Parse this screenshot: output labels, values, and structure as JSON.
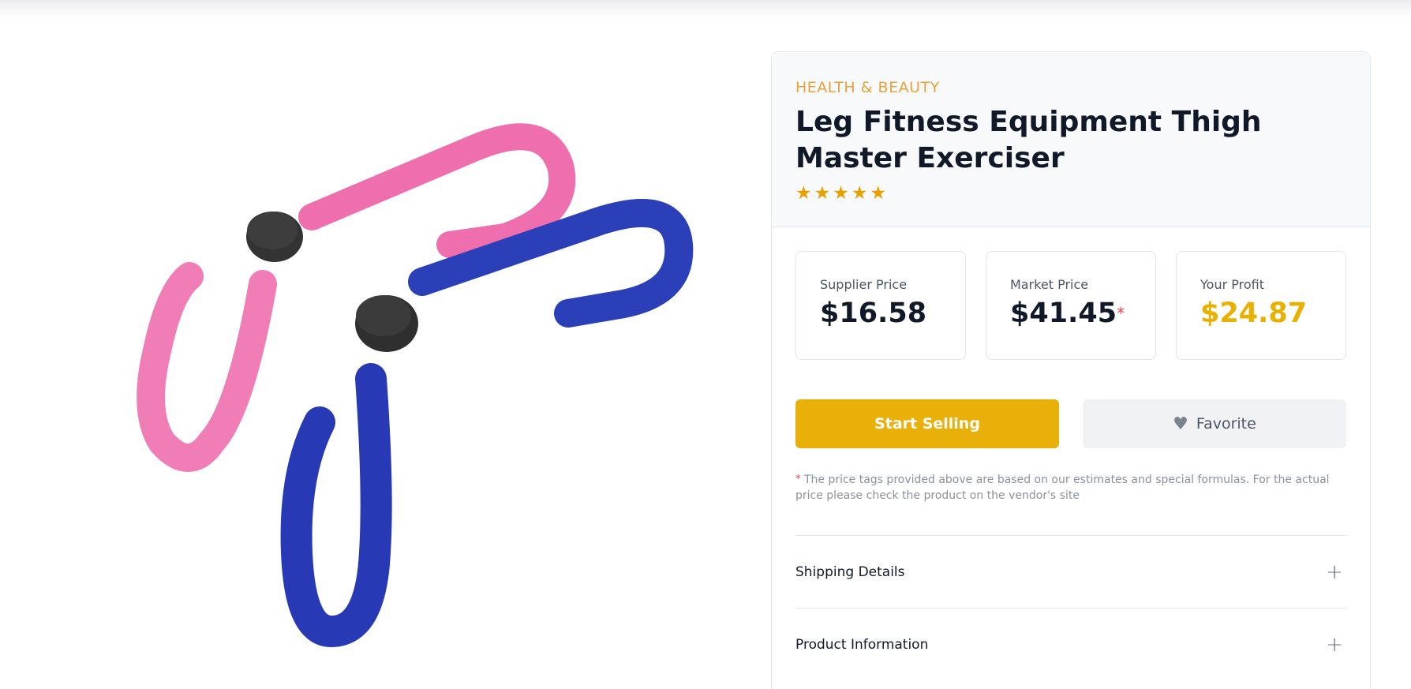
{
  "product": {
    "category": "HEALTH & BEAUTY",
    "title": "Leg Fitness Equipment Thigh Master Exerciser",
    "rating": 5,
    "image_alt": "Pink and blue thigh master exercisers"
  },
  "prices": {
    "supplier": {
      "label": "Supplier Price",
      "value": "$16.58"
    },
    "market": {
      "label": "Market Price",
      "value": "$41.45",
      "marker": "*"
    },
    "profit": {
      "label": "Your Profit",
      "value": "$24.87"
    }
  },
  "actions": {
    "start_selling": "Start Selling",
    "favorite": "Favorite"
  },
  "disclaimer": {
    "marker": "*",
    "text": "The price tags provided above are based on our estimates and special formulas. For the actual price please check the product on the vendor's site"
  },
  "accordion": {
    "shipping": "Shipping Details",
    "product_info": "Product Information"
  },
  "colors": {
    "accent": "#e8b008",
    "category": "#e8a23a",
    "star": "#e6a100",
    "pink_handle": "#ef6fae",
    "blue_handle": "#2a3fb8"
  }
}
